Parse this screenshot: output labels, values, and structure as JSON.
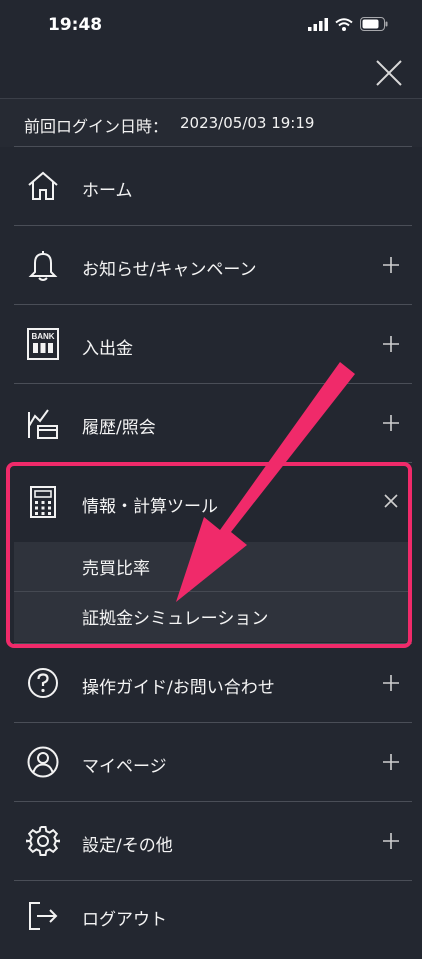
{
  "status_bar": {
    "time": "19:48"
  },
  "login": {
    "label": "前回ログイン日時：",
    "value": "2023/05/03 19:19"
  },
  "menu": {
    "home": "ホーム",
    "news": "お知らせ/キャンペーン",
    "deposit": "入出金",
    "history": "履歴/照会",
    "tools": "情報・計算ツール",
    "tools_sub": [
      "売買比率",
      "証拠金シミュレーション"
    ],
    "guide": "操作ガイド/お問い合わせ",
    "mypage": "マイページ",
    "settings": "設定/その他",
    "logout": "ログアウト"
  },
  "icons": {
    "home": "home-icon",
    "news": "bell-icon",
    "deposit": "bank-icon",
    "history": "history-icon",
    "tools": "calculator-icon",
    "guide": "question-icon",
    "mypage": "user-icon",
    "settings": "gear-icon",
    "logout": "logout-icon",
    "bank_text": "BANK"
  },
  "colors": {
    "background": "#232730",
    "highlight": "#f02a6a",
    "text": "#f2f2f2"
  }
}
